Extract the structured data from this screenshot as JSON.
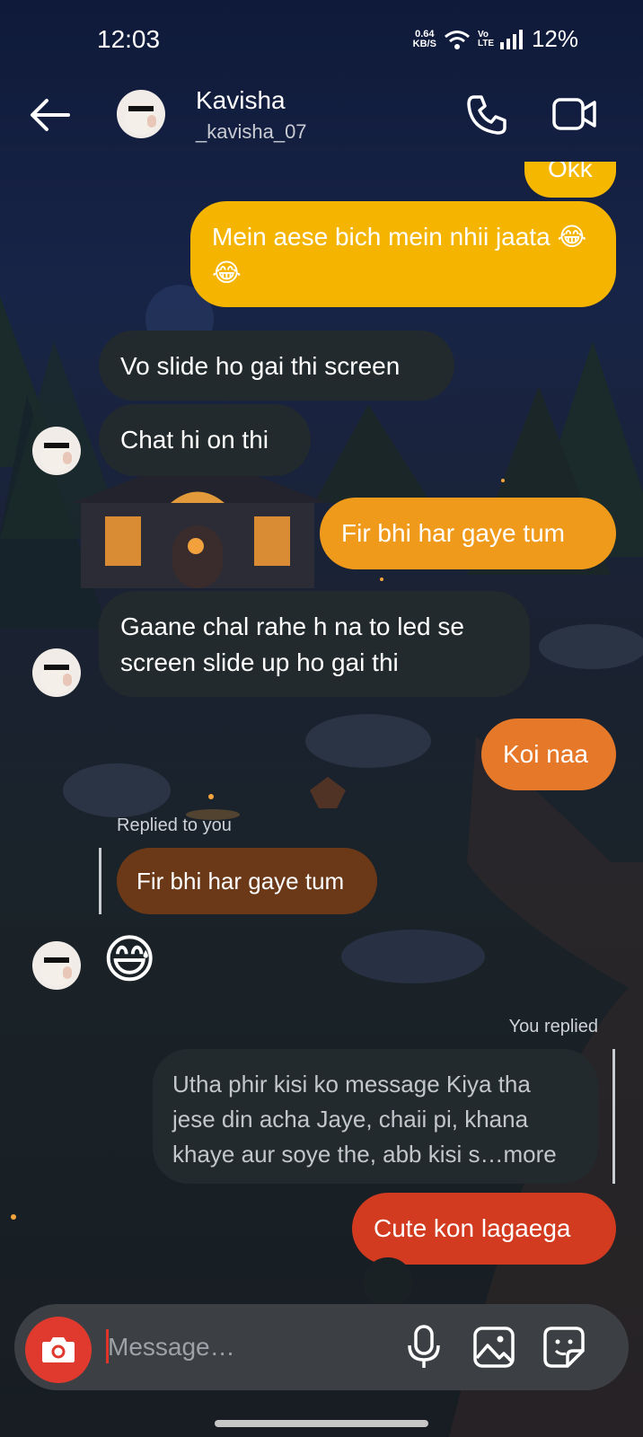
{
  "status_bar": {
    "time": "12:03",
    "net_speed_value": "0.64",
    "net_speed_unit": "KB/S",
    "volte": "Vo LTE",
    "battery": "12%"
  },
  "header": {
    "name": "Kavisha",
    "username": "_kavisha_07"
  },
  "messages": [
    {
      "text": "Okk"
    },
    {
      "text": "Mein aese bich mein nhii jaata 😂😂"
    },
    {
      "text": "Vo slide ho gai thi screen"
    },
    {
      "text": "Chat hi on thi"
    },
    {
      "text": "Fir bhi har gaye tum"
    },
    {
      "text": "Gaane chal rahe h na to led se screen slide up ho gai thi"
    },
    {
      "text": "Koi naa"
    },
    {
      "label": "Replied to you",
      "quoted": "Fir bhi har gaye tum",
      "emoji": "😅"
    },
    {
      "label": "You replied",
      "quoted": "Utha phir kisi ko message Kiya tha jese din acha Jaye, chaii pi, khana khaye aur soye the, abb kisi s…more",
      "text": "Cute kon lagaega"
    }
  ],
  "composer": {
    "placeholder": "Message…"
  },
  "colors": {
    "outgoing_top": "#f5b400",
    "outgoing_mid": "#f09a1c",
    "outgoing_bottom": "#d23b1f",
    "incoming": "#222a2d",
    "camera": "#e03a2e"
  }
}
